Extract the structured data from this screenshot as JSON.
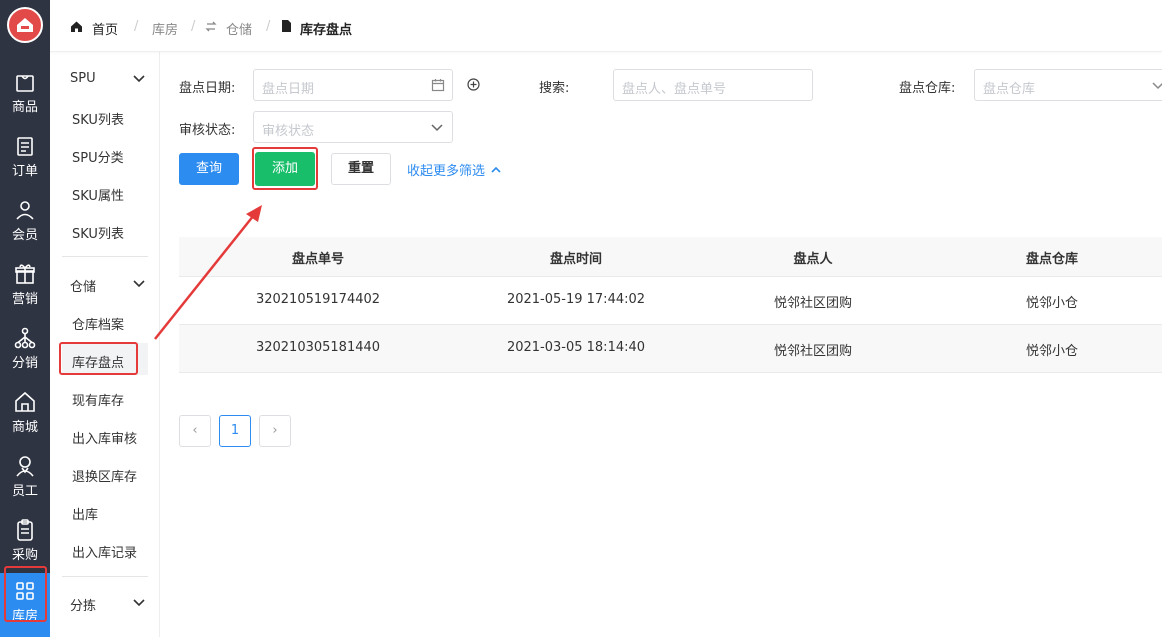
{
  "rail": {
    "items": [
      {
        "label": "商品",
        "icon": "bag-icon"
      },
      {
        "label": "订单",
        "icon": "document-icon"
      },
      {
        "label": "会员",
        "icon": "user-icon"
      },
      {
        "label": "营销",
        "icon": "gift-icon"
      },
      {
        "label": "分销",
        "icon": "network-icon"
      },
      {
        "label": "商城",
        "icon": "home-icon"
      },
      {
        "label": "员工",
        "icon": "staff-icon"
      },
      {
        "label": "采购",
        "icon": "clipboard-icon"
      },
      {
        "label": "库房",
        "icon": "grid-icon"
      }
    ],
    "active": "库房"
  },
  "sidebar": {
    "groups": [
      {
        "title": "SPU",
        "items": [
          "SKU列表",
          "SPU分类",
          "SKU属性",
          "SKU列表"
        ]
      },
      {
        "title": "仓储",
        "items": [
          "仓库档案",
          "库存盘点",
          "现有库存",
          "出入库审核",
          "退换区库存",
          "出库",
          "出入库记录"
        ]
      },
      {
        "title": "分拣",
        "items": []
      }
    ],
    "active_item": "库存盘点"
  },
  "breadcrumb": {
    "home": "首页",
    "level1": "库房",
    "level2": "仓储",
    "current": "库存盘点",
    "sep": "/"
  },
  "filters": {
    "date_label": "盘点日期:",
    "date_placeholder": "盘点日期",
    "search_label": "搜索:",
    "search_placeholder": "盘点人、盘点单号",
    "warehouse_label": "盘点仓库:",
    "warehouse_placeholder": "盘点仓库",
    "status_label": "审核状态:",
    "status_placeholder": "审核状态"
  },
  "actions": {
    "query": "查询",
    "add": "添加",
    "reset": "重置",
    "collapse": "收起更多筛选"
  },
  "table": {
    "columns": [
      "盘点单号",
      "盘点时间",
      "盘点人",
      "盘点仓库"
    ],
    "rows": [
      [
        "320210519174402",
        "2021-05-19 17:44:02",
        "悦邻社区团购",
        "悦邻小仓"
      ],
      [
        "320210305181440",
        "2021-03-05 18:14:40",
        "悦邻社区团购",
        "悦邻小仓"
      ]
    ]
  },
  "pagination": {
    "prev": "‹",
    "current": "1",
    "next": "›"
  },
  "colors": {
    "rail_bg": "#2f3443",
    "primary": "#2d8cf0",
    "success": "#19be6b",
    "highlight": "#e53a3a"
  }
}
